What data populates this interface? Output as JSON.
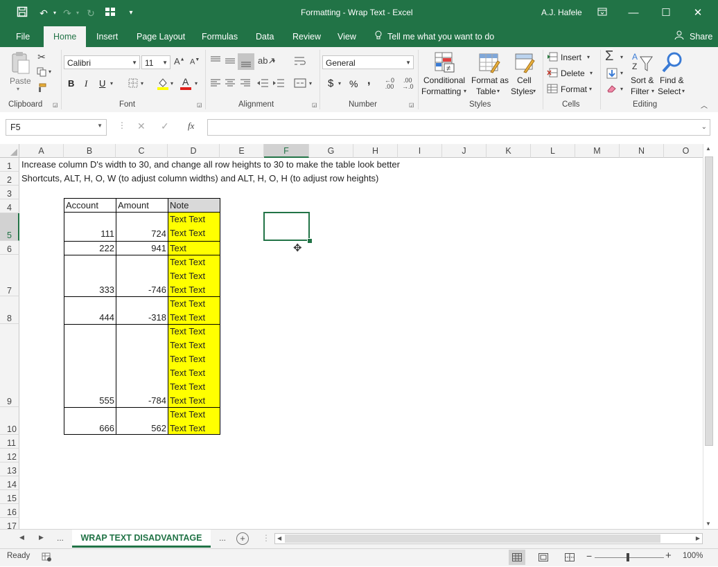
{
  "window": {
    "title": "Formatting - Wrap Text  -  Excel",
    "user": "A.J. Hafele"
  },
  "tabs": [
    "File",
    "Home",
    "Insert",
    "Page Layout",
    "Formulas",
    "Data",
    "Review",
    "View"
  ],
  "tell_me": "Tell me what you want to do",
  "share": "Share",
  "ribbon": {
    "clipboard": {
      "paste": "Paste",
      "label": "Clipboard"
    },
    "font": {
      "name": "Calibri",
      "size": "11",
      "bold": "B",
      "italic": "I",
      "underline": "U",
      "label": "Font"
    },
    "alignment": {
      "label": "Alignment"
    },
    "number": {
      "format": "General",
      "currency": "$",
      "percent": "%",
      "comma": ",",
      "label": "Number"
    },
    "styles": {
      "conditional": [
        "Conditional",
        "Formatting"
      ],
      "format_table": [
        "Format as",
        "Table"
      ],
      "cell_styles": [
        "Cell",
        "Styles"
      ],
      "label": "Styles"
    },
    "cells": {
      "insert": "Insert",
      "delete": "Delete",
      "format": "Format",
      "label": "Cells"
    },
    "editing": {
      "sort": [
        "Sort &",
        "Filter"
      ],
      "find": [
        "Find &",
        "Select"
      ],
      "label": "Editing"
    }
  },
  "formula_bar": {
    "name_box": "F5",
    "fx": "fx",
    "value": ""
  },
  "columns": [
    "A",
    "B",
    "C",
    "D",
    "E",
    "F",
    "G",
    "H",
    "I",
    "J",
    "K",
    "L",
    "M",
    "N",
    "O"
  ],
  "selected_column": "F",
  "rows": [
    "1",
    "2",
    "3",
    "4",
    "5",
    "6",
    "7",
    "8",
    "9",
    "10",
    "11",
    "12",
    "13",
    "14",
    "15",
    "16",
    "17"
  ],
  "sheet": {
    "a1": "Increase column D's width to 30, and change all row heights to 30 to make the table look better",
    "a2": "Shortcuts, ALT, H, O, W (to adjust column widths) and ALT, H, O, H (to adjust row heights)",
    "headers": [
      "Account",
      "Amount",
      "Note"
    ],
    "table": [
      {
        "account": "111",
        "amount": "724",
        "note": "Text Text Text Text"
      },
      {
        "account": "222",
        "amount": "941",
        "note": "Text"
      },
      {
        "account": "333",
        "amount": "-746",
        "note": "Text Text Text Text Text Text"
      },
      {
        "account": "444",
        "amount": "-318",
        "note": "Text Text Text Text"
      },
      {
        "account": "555",
        "amount": "-784",
        "note": "Text Text Text Text Text Text Text Text Text Text Text Text"
      },
      {
        "account": "666",
        "amount": "562",
        "note": "Text Text Text Text"
      }
    ]
  },
  "sheet_tab": "WRAP TEXT DISADVANTAGE",
  "sheet_ellipsis": "...",
  "status": {
    "ready": "Ready",
    "zoom": "100%"
  },
  "colors": {
    "excel_green": "#217346",
    "highlight": "#ffff00"
  }
}
